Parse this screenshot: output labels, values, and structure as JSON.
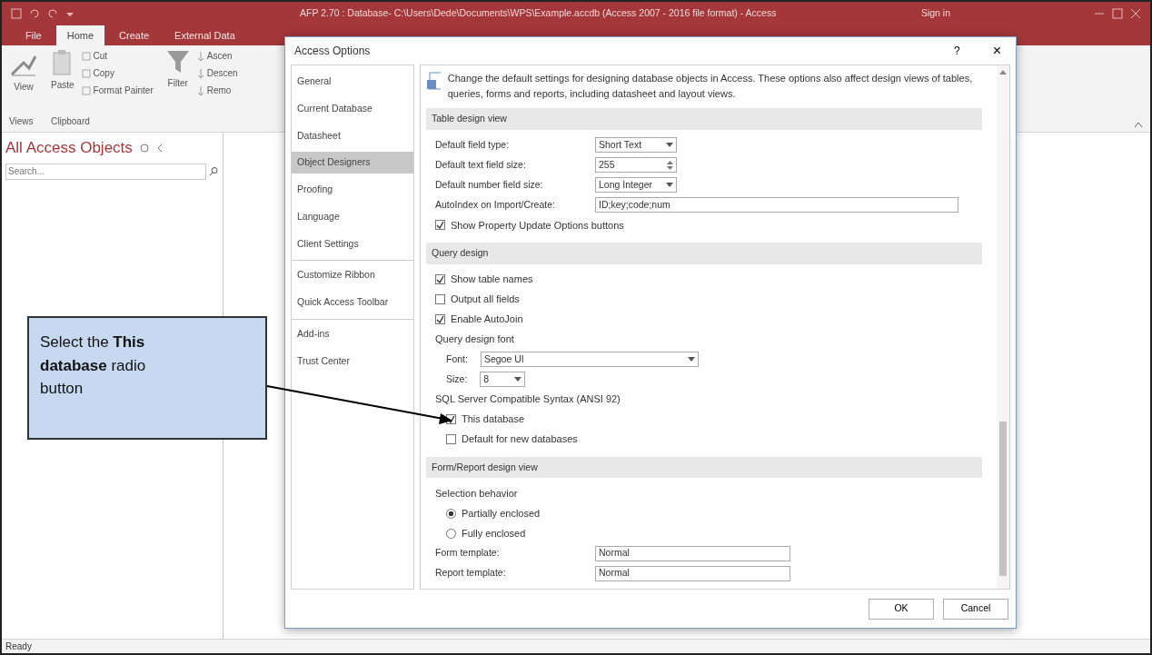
{
  "window": {
    "title": "AFP 2.70 : Database- C:\\Users\\Dede\\Documents\\WPS\\Example.accdb (Access 2007 - 2016 file format) - Access",
    "sign_in": "Sign in"
  },
  "ribbon_tabs": [
    {
      "label": "File",
      "selected": false
    },
    {
      "label": "Home",
      "selected": true
    },
    {
      "label": "Create",
      "selected": false
    },
    {
      "label": "External Data",
      "selected": false
    }
  ],
  "ribbon": {
    "view": "View",
    "paste": "Paste",
    "clipboard_items": [
      "Cut",
      "Copy",
      "Format Painter"
    ],
    "filter": "Filter",
    "sort_items": [
      "Ascen",
      "Descen",
      "Remo"
    ],
    "group_labels": [
      "Views",
      "Clipboard"
    ]
  },
  "nav_pane": {
    "title": "All Access Objects",
    "search_placeholder": "Search..."
  },
  "status_bar": "Ready",
  "dialog": {
    "title": "Access Options",
    "help": "?",
    "close": "×",
    "nav": [
      {
        "label": "General",
        "selected": false
      },
      {
        "label": "Current Database",
        "selected": false
      },
      {
        "label": "Datasheet",
        "selected": false
      },
      {
        "label": "Object Designers",
        "selected": true
      },
      {
        "label": "Proofing",
        "selected": false
      },
      {
        "label": "Language",
        "selected": false
      },
      {
        "label": "Client Settings",
        "selected": false
      },
      {
        "label": "Customize Ribbon",
        "selected": false
      },
      {
        "label": "Quick Access Toolbar",
        "selected": false
      },
      {
        "label": "Add-ins",
        "selected": false
      },
      {
        "label": "Trust Center",
        "selected": false
      }
    ],
    "intro": "Change the default settings for designing database objects in Access. These options also affect design views of tables, queries, forms and reports, including datasheet and layout views.",
    "sections": [
      {
        "title": "Table design view",
        "rows": [
          {
            "kind": "select",
            "label": "Default field type:",
            "value": "Short Text"
          },
          {
            "kind": "spin",
            "label": "Default text field size:",
            "value": "255"
          },
          {
            "kind": "select",
            "label": "Default number field size:",
            "value": "Long Integer"
          },
          {
            "kind": "text",
            "label": "AutoIndex on Import/Create:",
            "value": "ID;key;code;num"
          },
          {
            "kind": "checkbox",
            "label": "Show Property Update Options buttons",
            "checked": true
          }
        ]
      },
      {
        "title": "Query design",
        "rows": [
          {
            "kind": "checkbox",
            "label": "Show table names",
            "checked": true
          },
          {
            "kind": "checkbox",
            "label": "Output all fields",
            "checked": false
          },
          {
            "kind": "checkbox",
            "label": "Enable AutoJoin",
            "checked": true
          },
          {
            "kind": "group",
            "label": "Query design font",
            "children": [
              {
                "kind": "select",
                "label": "Font:",
                "value": "Segoe UI"
              },
              {
                "kind": "select",
                "label": "Size:",
                "value": "8"
              }
            ]
          },
          {
            "kind": "group",
            "label": "SQL Server Compatible Syntax (ANSI 92)",
            "children": [
              {
                "kind": "checkbox",
                "label": "This database",
                "checked": true
              },
              {
                "kind": "checkbox",
                "label": "Default for new databases",
                "checked": false
              }
            ]
          }
        ]
      },
      {
        "title": "Form/Report design view",
        "rows": [
          {
            "kind": "group",
            "label": "Selection behavior",
            "children": [
              {
                "kind": "radio",
                "label": "Partially enclosed",
                "selected": true
              },
              {
                "kind": "radio",
                "label": "Fully enclosed",
                "selected": false
              }
            ]
          },
          {
            "kind": "text",
            "label": "Form template:",
            "value": "Normal"
          },
          {
            "kind": "text",
            "label": "Report template:",
            "value": "Normal"
          }
        ]
      }
    ],
    "buttons": [
      "OK",
      "Cancel"
    ]
  },
  "callout": "Select the **This database** radio button"
}
